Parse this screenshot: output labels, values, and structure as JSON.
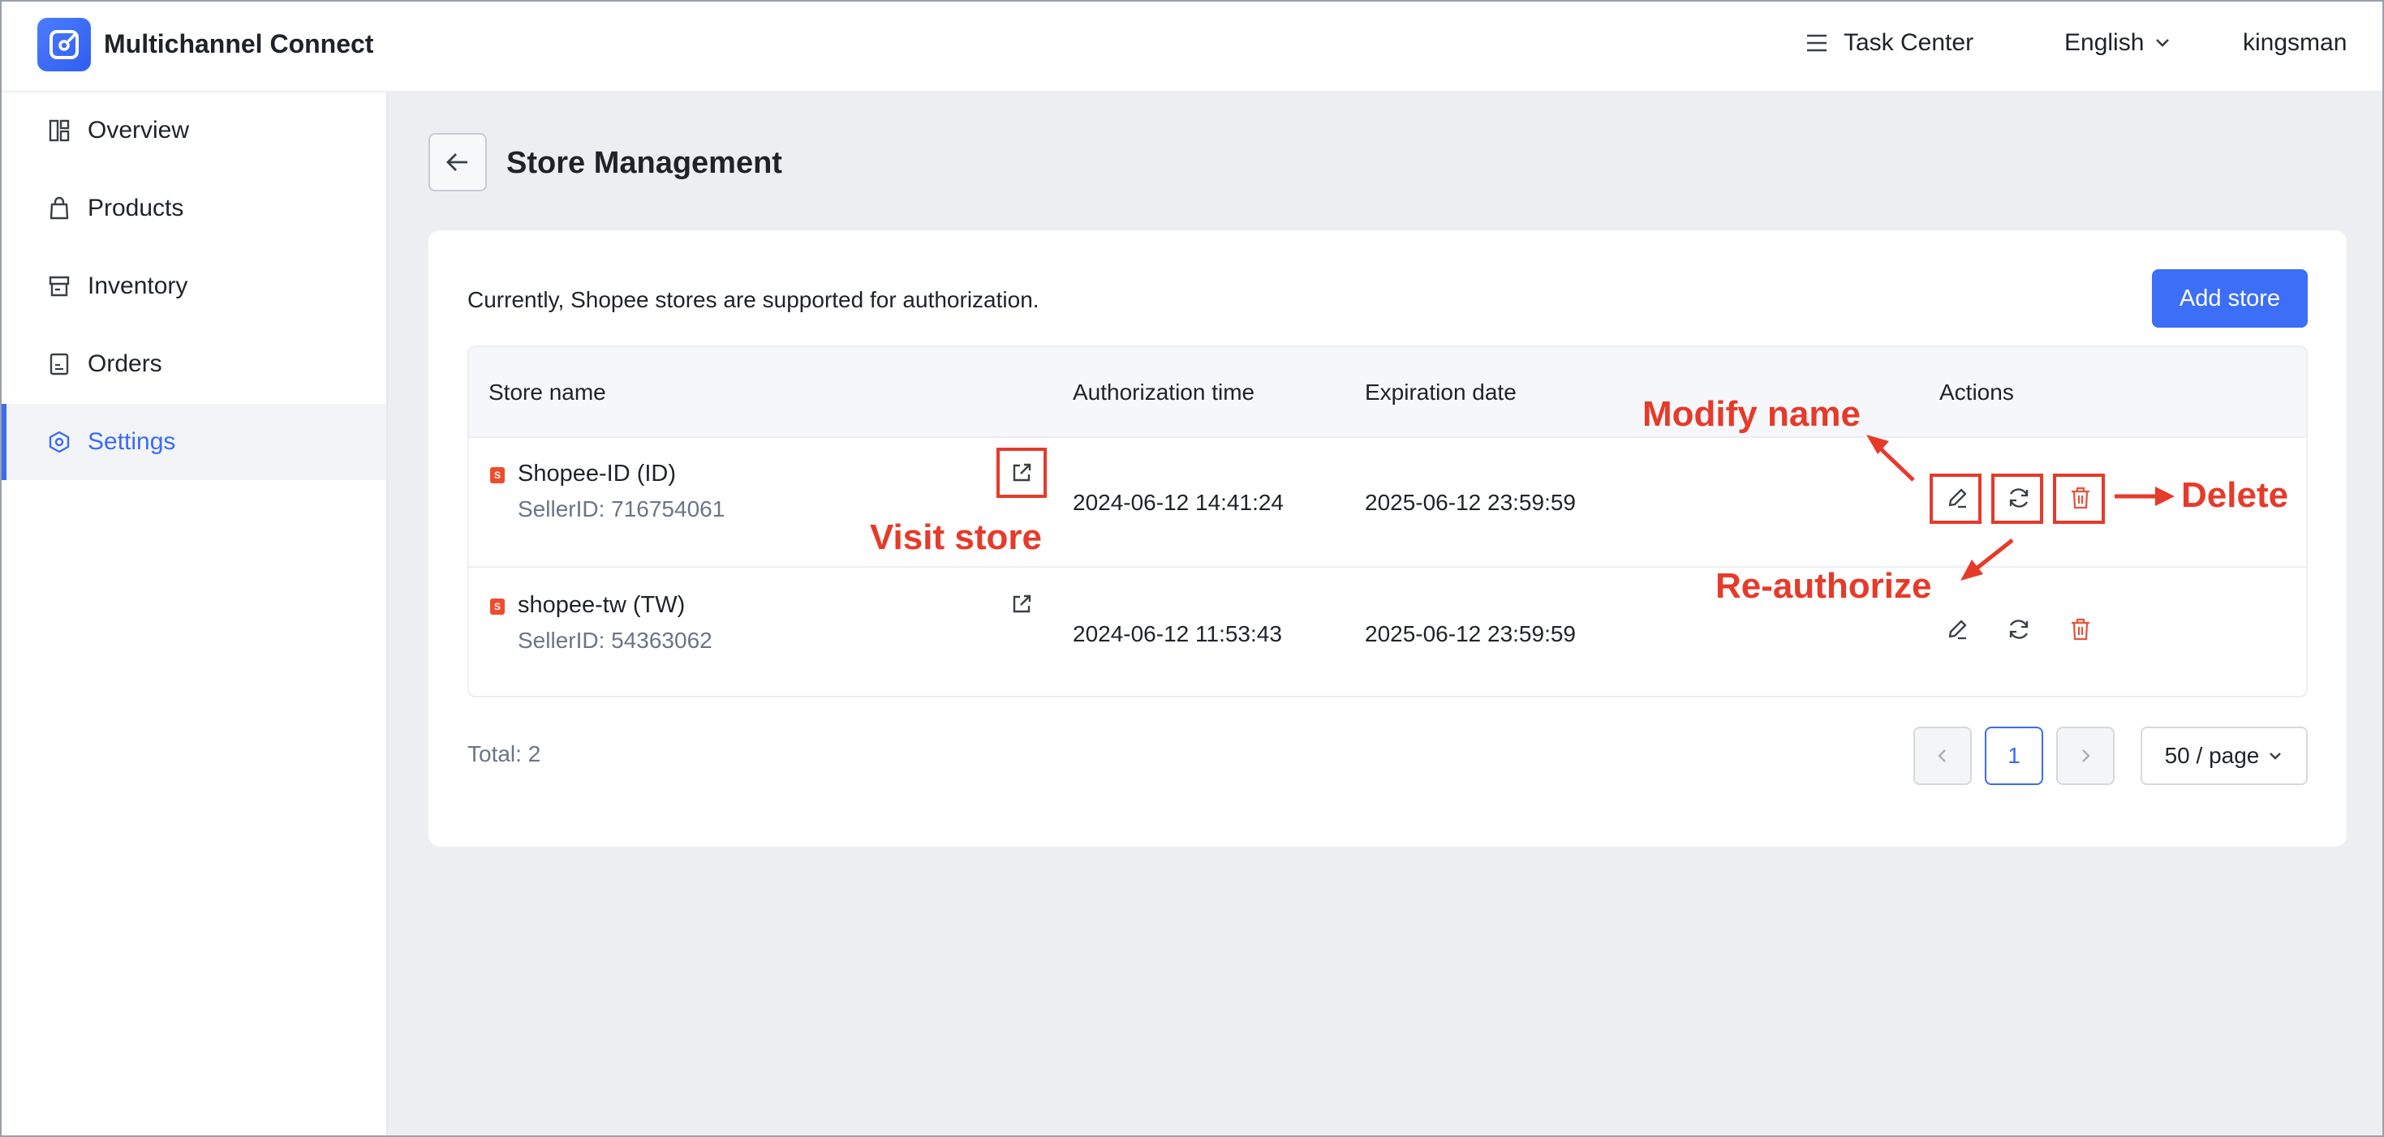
{
  "app": {
    "title": "Multichannel Connect"
  },
  "header": {
    "task_center": "Task Center",
    "language": "English",
    "user": "kingsman"
  },
  "sidebar": {
    "items": [
      {
        "label": "Overview",
        "icon": "overview-icon"
      },
      {
        "label": "Products",
        "icon": "bag-icon"
      },
      {
        "label": "Inventory",
        "icon": "store-icon"
      },
      {
        "label": "Orders",
        "icon": "orders-icon"
      },
      {
        "label": "Settings",
        "icon": "settings-icon",
        "active": true
      }
    ]
  },
  "page": {
    "title": "Store Management",
    "notice": "Currently, Shopee stores are supported for authorization.",
    "add_store": "Add store"
  },
  "table": {
    "columns": [
      "Store name",
      "Authorization time",
      "Expiration date",
      "Actions"
    ],
    "rows": [
      {
        "store_name": "Shopee-ID (ID)",
        "seller_id": "SellerID: 716754061",
        "authorization_time": "2024-06-12 14:41:24",
        "expiration_date": "2025-06-12 23:59:59"
      },
      {
        "store_name": "shopee-tw (TW)",
        "seller_id": "SellerID: 54363062",
        "authorization_time": "2024-06-12 11:53:43",
        "expiration_date": "2025-06-12 23:59:59"
      }
    ]
  },
  "pagination": {
    "total": "Total: 2",
    "current_page": "1",
    "page_size": "50 / page"
  },
  "annotations": {
    "visit_store": "Visit store",
    "modify_name": "Modify name",
    "re_authorize": "Re-authorize",
    "delete": "Delete"
  },
  "colors": {
    "accent": "#3d6ef7",
    "annotation": "#e63a2a",
    "shopee": "#ee4d2d",
    "delete": "#e5533d"
  }
}
